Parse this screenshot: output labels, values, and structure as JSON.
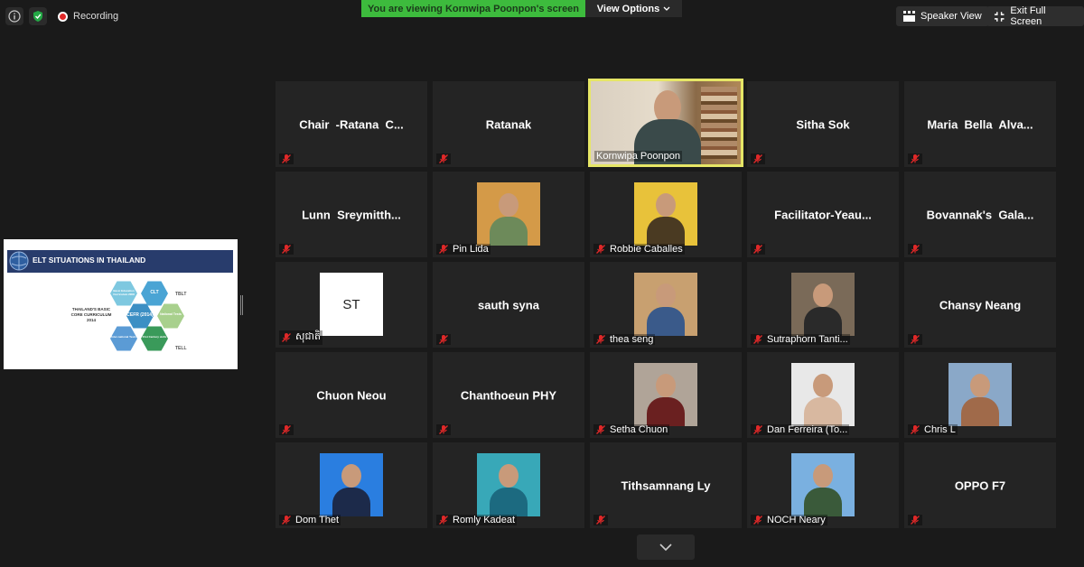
{
  "top": {
    "recording_label": "Recording",
    "viewing_banner": "You are viewing Kornwipa Poonpon's screen",
    "view_options_label": "View Options",
    "speaker_view_label": "Speaker View",
    "exit_fullscreen_label": "Exit Full Screen"
  },
  "shared_screen": {
    "slide_title": "ELT SITUATIONS IN THAILAND",
    "caption": "THAILAND'S BASIC CORE CURRICULUM 2014",
    "hex_labels": [
      "Basic Education Curriculum 2008",
      "CLT",
      "CEFR (2014)",
      "National Tests",
      "Inter-national Tests",
      "21st Century skills"
    ],
    "side_labels": [
      "TBLT",
      "TELL"
    ]
  },
  "participants": [
    {
      "name": "Chair  -Ratana  C...",
      "label": ""
    },
    {
      "name": "Ratanak",
      "label": ""
    },
    {
      "name": "",
      "label": "Kornwipa Poonpon",
      "active": true
    },
    {
      "name": "Sitha Sok",
      "label": ""
    },
    {
      "name": "Maria  Bella  Alva...",
      "label": ""
    },
    {
      "name": "Lunn  Sreymitth...",
      "label": ""
    },
    {
      "name": "",
      "label": "Pin Lida"
    },
    {
      "name": "",
      "label": "Robbie Caballes"
    },
    {
      "name": "Facilitator-Yeau...",
      "label": ""
    },
    {
      "name": "Bovannak's  Gala...",
      "label": ""
    },
    {
      "name": "",
      "label": "សុជាតិ",
      "avatar_text": "ST"
    },
    {
      "name": "sauth syna",
      "label": ""
    },
    {
      "name": "",
      "label": "thea seng"
    },
    {
      "name": "",
      "label": "Sutraphorn Tanti..."
    },
    {
      "name": "Chansy Neang",
      "label": ""
    },
    {
      "name": "Chuon Neou",
      "label": ""
    },
    {
      "name": "Chanthoeun PHY",
      "label": ""
    },
    {
      "name": "",
      "label": "Setha Chuon"
    },
    {
      "name": "",
      "label": "Dan Ferreira (To..."
    },
    {
      "name": "",
      "label": "Chris L"
    },
    {
      "name": "",
      "label": "Dom Thet"
    },
    {
      "name": "",
      "label": "Romly Kadeat"
    },
    {
      "name": "Tithsamnang Ly",
      "label": ""
    },
    {
      "name": "",
      "label": "NOCH Neary"
    },
    {
      "name": "OPPO F7",
      "label": ""
    }
  ],
  "colors": {
    "banner_green": "#3dbb3d",
    "active_border": "#e6e666",
    "muted_red": "#e02828"
  }
}
